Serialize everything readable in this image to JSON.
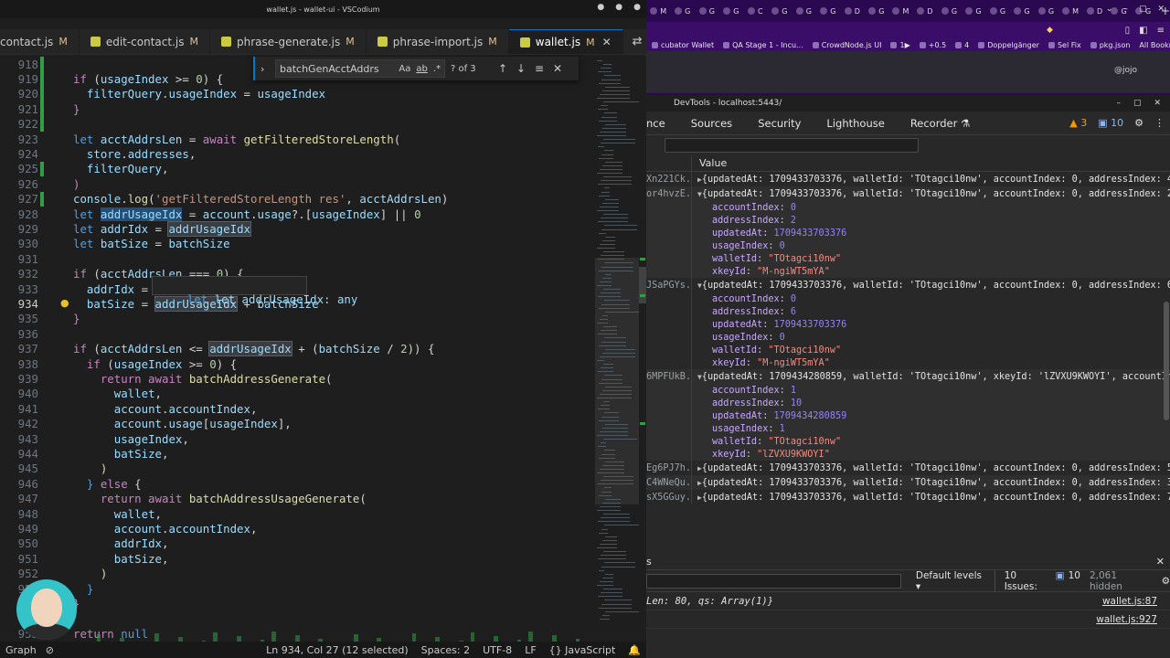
{
  "editor": {
    "window_title": "wallet.js - wallet-ui - VSCodium",
    "tabs": [
      {
        "label": "contact.js",
        "mod": "M",
        "active": false
      },
      {
        "label": "edit-contact.js",
        "mod": "M",
        "active": false
      },
      {
        "label": "phrase-generate.js",
        "mod": "M",
        "active": false
      },
      {
        "label": "phrase-import.js",
        "mod": "M",
        "active": false
      },
      {
        "label": "wallet.js",
        "mod": "M",
        "active": true
      }
    ],
    "find": {
      "query": "batchGenAcctAddrs",
      "count": "? of 3",
      "opt_case": "Aa",
      "opt_word": "ab",
      "opt_regex": ".*"
    },
    "hover_text": "let addrUsageIdx: any",
    "line_numbers": [
      "918",
      "919",
      "920",
      "921",
      "922",
      "923",
      "924",
      "925",
      "926",
      "927",
      "928",
      "929",
      "930",
      "931",
      "932",
      "933",
      "934",
      "935",
      "936",
      "937",
      "938",
      "939",
      "940",
      "941",
      "942",
      "943",
      "944",
      "945",
      "946",
      "947",
      "948",
      "949",
      "950",
      "951",
      "952",
      "953",
      "954",
      "955"
    ],
    "status": {
      "branch": "Graph",
      "position": "Ln 934, Col 27 (12 selected)",
      "spaces": "Spaces: 2",
      "encoding": "UTF-8",
      "eol": "LF",
      "language": "{} JavaScript"
    }
  },
  "browser": {
    "tab_initials": [
      "M",
      "G",
      "G",
      "G",
      "C",
      "G",
      "G",
      "G",
      "D",
      "G",
      "M",
      "D",
      "G",
      "G",
      "G",
      "G",
      "G",
      "M",
      "D",
      "G",
      "G"
    ],
    "bookmarks": [
      "cubator Wallet",
      "QA Stage 1 - Incu...",
      "CrowdNode.js UI",
      "1▶",
      "+0.5",
      "4",
      "Doppelgänger",
      "Sel Fix",
      "pkg.json"
    ],
    "all_bookmarks": "All Bookmarks",
    "page_user": "@jojo"
  },
  "devtools": {
    "title": "DevTools - localhost:5443/",
    "tabs": [
      "nce",
      "Sources",
      "Security",
      "Lighthouse",
      "Recorder"
    ],
    "warn_count": "3",
    "msg_count": "10",
    "table_header": "Value",
    "rows": [
      {
        "key": "Xn221Ck...",
        "summary": "{updatedAt: 1709433703376, walletId: 'TOtagci10nw', accountIndex: 0, addressIndex: 4",
        "expanded": false,
        "partial": true
      },
      {
        "key": "or4hvzE...",
        "summary": "{updatedAt: 1709433703376, walletId: 'TOtagci10nw', accountIndex: 0, addressIndex: 2",
        "expanded": true,
        "props": [
          [
            "accountIndex",
            "0"
          ],
          [
            "addressIndex",
            "2"
          ],
          [
            "updatedAt",
            "1709433703376"
          ],
          [
            "usageIndex",
            "0"
          ],
          [
            "walletId",
            "\"TOtagci10nw\""
          ],
          [
            "xkeyId",
            "\"M-ngiWT5mYA\""
          ]
        ]
      },
      {
        "key": "JSaPGYs...",
        "summary": "{updatedAt: 1709433703376, walletId: 'TOtagci10nw', accountIndex: 0, addressIndex: 6",
        "expanded": true,
        "props": [
          [
            "accountIndex",
            "0"
          ],
          [
            "addressIndex",
            "6"
          ],
          [
            "updatedAt",
            "1709433703376"
          ],
          [
            "usageIndex",
            "0"
          ],
          [
            "walletId",
            "\"TOtagci10nw\""
          ],
          [
            "xkeyId",
            "\"M-ngiWT5mYA\""
          ]
        ]
      },
      {
        "key": "6MPFUkB...",
        "summary": "{updatedAt: 1709434280859, walletId: 'TOtagci10nw', xkeyId: 'lZVXU9KWOYI', accountIn",
        "expanded": true,
        "props": [
          [
            "accountIndex",
            "1"
          ],
          [
            "addressIndex",
            "10"
          ],
          [
            "updatedAt",
            "1709434280859"
          ],
          [
            "usageIndex",
            "1"
          ],
          [
            "walletId",
            "\"TOtagci10nw\""
          ],
          [
            "xkeyId",
            "\"lZVXU9KWOYI\""
          ]
        ]
      },
      {
        "key": "Eg6PJ7h...",
        "summary": "{updatedAt: 1709433703376, walletId: 'TOtagci10nw', accountIndex: 0, addressIndex: 5",
        "expanded": false
      },
      {
        "key": "C4WNeQu...",
        "summary": "{updatedAt: 1709433703376, walletId: 'TOtagci10nw', accountIndex: 0, addressIndex: 3",
        "expanded": false
      },
      {
        "key": "sX5GGuy...",
        "summary": "{updatedAt: 1709433703376, walletId: 'TOtagci10nw', accountIndex: 0, addressIndex: 7",
        "expanded": false
      }
    ],
    "console": {
      "header": "s",
      "default_levels": "Default levels ▾",
      "issues_label": "10 Issues:",
      "issues_count": "10",
      "hidden": "2,061 hidden",
      "lines": [
        {
          "text": "Len: 80, qs: Array(1)}",
          "link": "wallet.js:87"
        },
        {
          "text": "",
          "link": "wallet.js:927"
        }
      ]
    }
  }
}
